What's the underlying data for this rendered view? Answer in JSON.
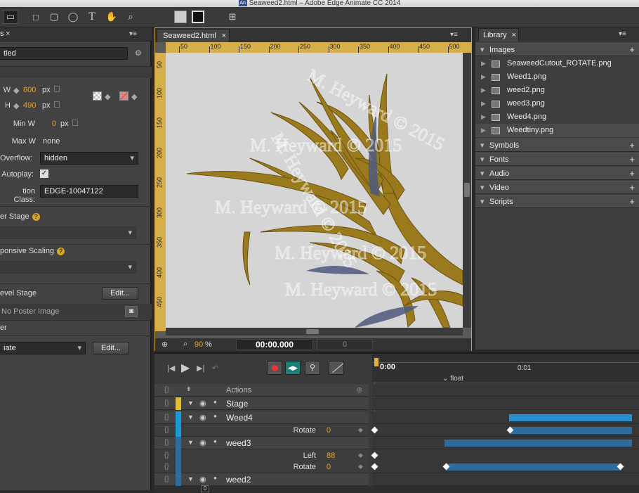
{
  "window": {
    "title": "Seaweed2.html – Adobe Edge Animate CC 2014",
    "app_icon": "An"
  },
  "properties": {
    "tab_label": "s",
    "stage_name": "tled",
    "w_label": "W",
    "w_value": "600",
    "w_unit": "px",
    "h_label": "H",
    "h_value": "490",
    "h_unit": "px",
    "minw_label": "Min W",
    "minw_value": "0",
    "minw_unit": "px",
    "maxw_label": "Max W",
    "maxw_value": "none",
    "overflow_label": "Overflow:",
    "overflow_value": "hidden",
    "autoplay_label": "Autoplay:",
    "autoplay_check": "✓",
    "class_label": "tion Class:",
    "class_value": "EDGE-10047122",
    "poster_stage": "er Stage",
    "responsive": "ponsive Scaling",
    "level_stage": "evel Stage",
    "edit_label": "Edit...",
    "no_poster": "No Poster Image",
    "er": "er",
    "iate": "iate",
    "edit2_label": "Edit..."
  },
  "stage": {
    "tab_label": "Seaweed2.html",
    "ruler_h": [
      "50",
      "100",
      "150",
      "200",
      "250",
      "300",
      "350",
      "400",
      "450",
      "500",
      "550",
      "600"
    ],
    "ruler_v": [
      "50",
      "100",
      "150",
      "200",
      "250",
      "300",
      "350",
      "400",
      "450"
    ],
    "zoom_value": "90",
    "zoom_unit": "%",
    "timecode": "00:00.000",
    "frame": "0",
    "watermark": "M. Heyward © 2015"
  },
  "library": {
    "tab_label": "Library",
    "sections": [
      "Images",
      "Symbols",
      "Fonts",
      "Audio",
      "Video",
      "Scripts"
    ],
    "images": [
      "SeaweedCutout_ROTATE.png",
      "Weed1.png",
      "weed2.png",
      "weed3.png",
      "Weed4.png",
      "Weedtiny.png"
    ]
  },
  "timeline": {
    "time0": "0:00",
    "time1": "0:01",
    "float_label": "float",
    "actions": "Actions",
    "stage": "Stage",
    "weed4": "Weed4",
    "weed4_rotate_label": "Rotate",
    "weed4_rotate": "0",
    "weed3": "weed3",
    "weed3_left_label": "Left",
    "weed3_left": "88",
    "weed3_rotate_label": "Rotate",
    "weed3_rotate": "0",
    "weed2": "weed2",
    "bottom_frame": "0"
  }
}
